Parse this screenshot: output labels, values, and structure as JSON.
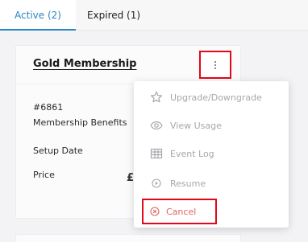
{
  "tabs": [
    {
      "label": "Active (2)"
    },
    {
      "label": "Expired (1)"
    }
  ],
  "card": {
    "title": "Gold Membership",
    "id": "#6861",
    "benefits_label": "Membership Benefits",
    "setup_label": "Setup Date",
    "price_label": "Price",
    "price_peek": "£"
  },
  "menu": {
    "items": [
      {
        "label": "Upgrade/Downgrade",
        "icon": "star-icon"
      },
      {
        "label": "View Usage",
        "icon": "eye-icon"
      },
      {
        "label": "Event Log",
        "icon": "table-icon"
      },
      {
        "label": "Resume",
        "icon": "play-circle-icon"
      },
      {
        "label": "Cancel",
        "icon": "cancel-circle-icon"
      }
    ]
  },
  "colors": {
    "accent": "#2b86c5",
    "highlight_box": "#e3071a",
    "cancel_text": "#e0655d",
    "disabled_text": "#a7a7ad"
  }
}
